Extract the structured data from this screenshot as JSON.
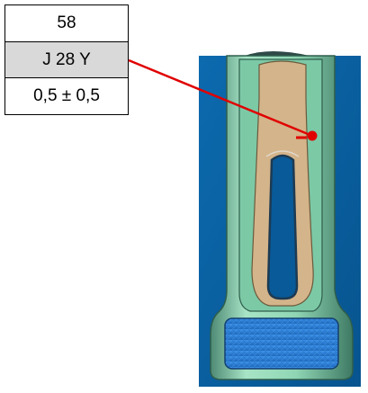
{
  "label": {
    "id": "58",
    "code": "J 28 Y",
    "tolerance": "0,5 ± 0,5"
  },
  "colors": {
    "background_blue": "#0a63a8",
    "body_green": "#8fd6b4",
    "insert_tan": "#d4b48a",
    "pad_blue": "#2d7fd6",
    "marker_red": "#e00000"
  },
  "icons": {
    "leader": "red-leader-line",
    "target": "red-dot-marker"
  }
}
